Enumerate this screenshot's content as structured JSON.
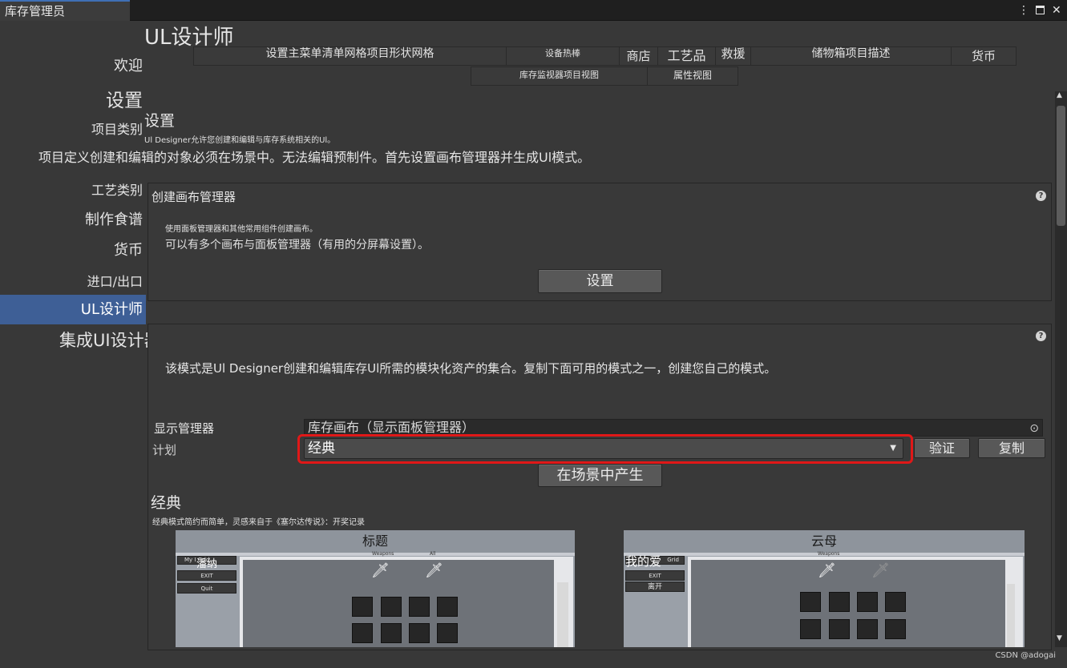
{
  "window": {
    "tab_title": "库存管理员",
    "menu_icon": "kebab-menu-icon",
    "maximize_icon": "maximize-icon",
    "close_glyph": "✕"
  },
  "sidebar": {
    "items": [
      {
        "label": "欢迎"
      },
      {
        "label": "设置"
      },
      {
        "label": "项目类别"
      },
      {
        "label": "项目定义创建和编辑的对象必须在场景中。无法编辑预制件。首先设置画布管理器并生成Ul模式。"
      },
      {
        "label": "工艺类别"
      },
      {
        "label": "制作食谱"
      },
      {
        "label": "货币"
      },
      {
        "label": "进口/出口"
      },
      {
        "label": "UL设计师"
      },
      {
        "label": "集成UI设计器架构"
      }
    ]
  },
  "main": {
    "title": "UL设计师",
    "tabs_row1": [
      "设置主菜单清单网格项目形状网格",
      "设备热棒",
      "商店",
      "工艺品",
      "救援",
      "储物箱项目描述",
      "货币"
    ],
    "tabs_row2": [
      "库存监视器项目视图",
      "属性视图"
    ],
    "settings_heading": "设置",
    "settings_desc": "Ul Designer允许您创建和编辑与库存系统相关的Ul。",
    "canvas_section": {
      "title": "创建画布管理器",
      "line1": "使用面板管理器和其他常用组件创建画布。",
      "line2": "可以有多个画布与面板管理器（有用的分屏幕设置）。",
      "button": "设置",
      "help": "?"
    },
    "schema_section": {
      "help": "?",
      "desc": "该模式是Ul Designer创建和编辑库存Ul所需的模块化资产的集合。复制下面可用的模式之一，创建您自己的模式。",
      "display_manager_label": "显示管理器",
      "display_manager_value": "库存画布（显示面板管理器）",
      "plan_label": "计划",
      "plan_value": "经典",
      "validate_button": "验证",
      "copy_button": "复制",
      "spawn_button": "在场景中产生",
      "classic_heading": "经典",
      "classic_desc": "经典模式简约而简单，灵感来自于《塞尔达传说》：开奖记录"
    },
    "previews": [
      {
        "title": "标题",
        "menu": [
          "潘纳",
          "EXIT",
          "Quit"
        ],
        "menu_extra": "My I   Grid",
        "labels": [
          "Weapons",
          "All"
        ]
      },
      {
        "title": "云母",
        "menu": [
          "我的爱",
          "EXIT",
          "离开"
        ],
        "menu_extra": "Grid",
        "labels": [
          "Weapons"
        ]
      }
    ]
  },
  "watermark": "CSDN @adogai",
  "colors": {
    "accent": "#3e5f96",
    "highlight": "#e01818",
    "background": "#383838"
  }
}
